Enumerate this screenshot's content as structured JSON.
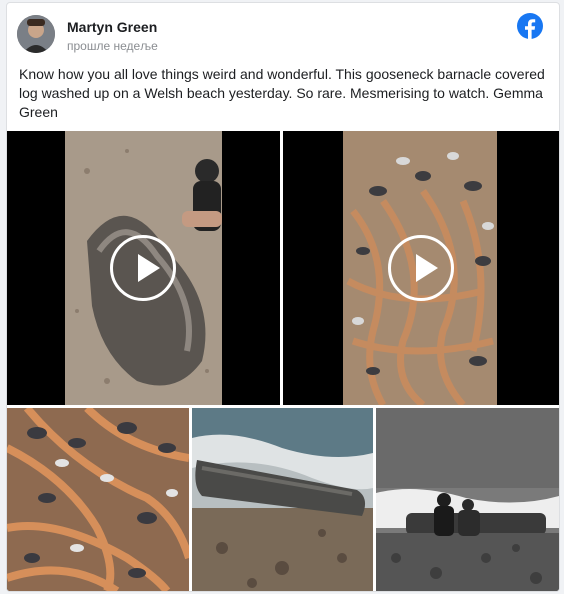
{
  "post": {
    "author": "Martyn Green",
    "time": "прошле недеље",
    "text": "Know how you all love things weird and wonderful. This gooseneck barnacle covered log washed up on a Welsh beach yesterday. So rare. Mesmerising to watch. Gemma Green"
  },
  "icons": {
    "brand": "facebook-logo-icon",
    "play": "play-icon"
  },
  "colors": {
    "facebook_blue": "#1877f2",
    "barnacle_orange": "#b86a3c"
  }
}
